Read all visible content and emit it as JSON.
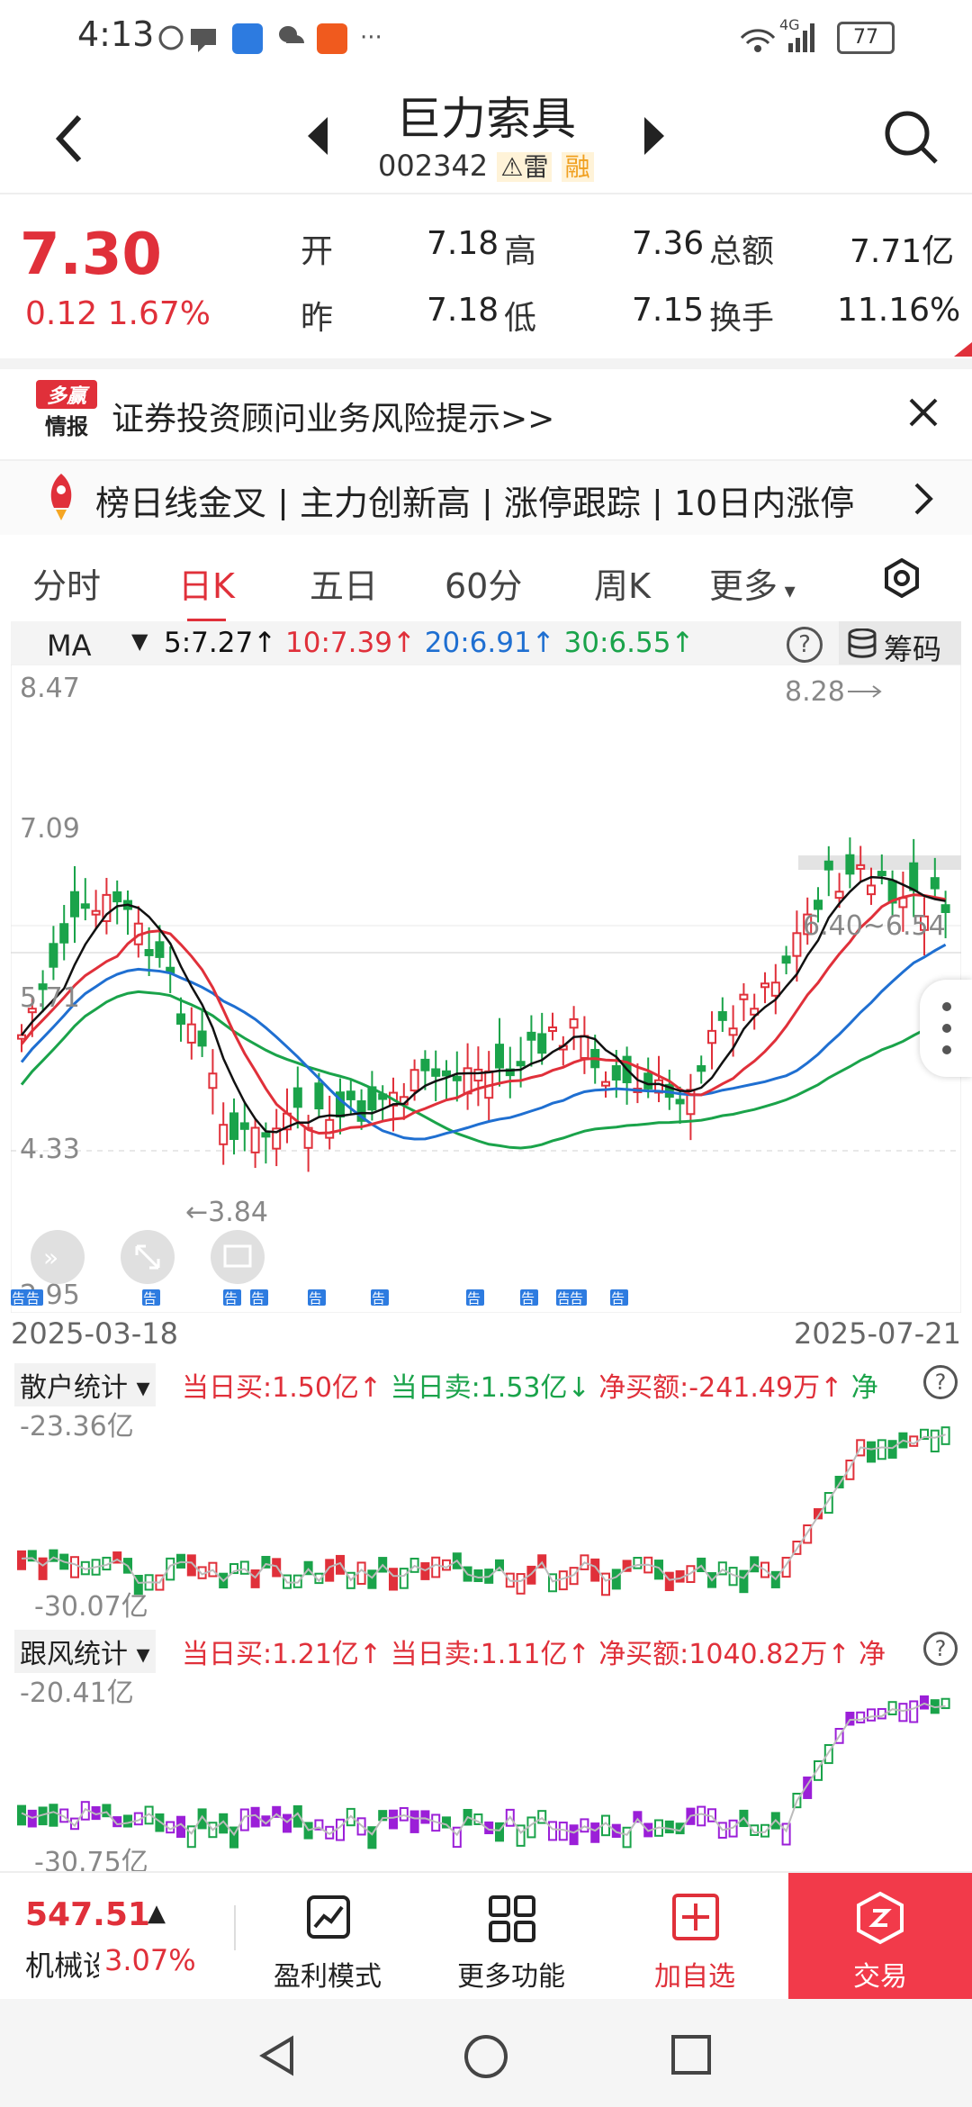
{
  "status_bar": {
    "time": "4:13",
    "network": "4G",
    "battery": "77"
  },
  "header": {
    "title": "巨力索具",
    "code": "002342",
    "tag_lei": "雷",
    "tag_rong": "融"
  },
  "quote": {
    "price": "7.30",
    "change": "0.12",
    "change_pct": "1.67%",
    "open_label": "开",
    "open": "7.18",
    "high_label": "高",
    "high": "7.36",
    "total_label": "总额",
    "total": "7.71亿",
    "prev_label": "昨",
    "prev": "7.18",
    "low_label": "低",
    "low": "7.15",
    "turnover_label": "换手",
    "turnover": "11.16%"
  },
  "risk_notice": {
    "badge_top": "多赢",
    "badge_bottom": "情报",
    "text": "证券投资顾问业务风险提示>>"
  },
  "ticker": {
    "text": "榜日线金叉 | 主力创新高 | 涨停跟踪 | 10日内涨停"
  },
  "tabs": [
    "分时",
    "日K",
    "五日",
    "60分",
    "周K",
    "更多"
  ],
  "active_tab": "日K",
  "ma_bar": {
    "selector": "MA",
    "ma5": "5:7.27↑",
    "ma10": "10:7.39↑",
    "ma20": "20:6.91↑",
    "ma30": "30:6.55↑",
    "help": "?",
    "chips": "筹码"
  },
  "main_chart": {
    "y_labels": [
      "8.47",
      "7.09",
      "5.71",
      "4.33",
      "2.95"
    ],
    "annotations": {
      "high": "8.28",
      "low": "←3.84",
      "range": "6.40~6.54"
    },
    "x_start": "2025-03-18",
    "x_end": "2025-07-21",
    "news_marker": "告"
  },
  "retail": {
    "name": "散户统计",
    "buy": "当日买:1.50亿↑",
    "sell": "当日卖:1.53亿↓",
    "net": "净买额:-241.49万↑",
    "more": "净",
    "top": "-23.36亿",
    "bottom": "-30.07亿"
  },
  "follow": {
    "name": "跟风统计",
    "buy": "当日买:1.21亿↑",
    "sell": "当日卖:1.11亿↑",
    "net": "净买额:1040.82万↑",
    "more": "净",
    "top": "-20.41亿",
    "bottom": "-30.75亿"
  },
  "toolbar": {
    "index_value": "547.51",
    "index_name": "机械设",
    "index_pct": "3.07%",
    "profit": "盈利模式",
    "more": "更多功能",
    "add": "加自选",
    "trade": "交易"
  },
  "colors": {
    "up": "#e0303a",
    "down": "#1aa34a",
    "ma5": "#111111",
    "ma10": "#e0303a",
    "ma20": "#1f6fd1",
    "ma30": "#1aa34a"
  }
}
